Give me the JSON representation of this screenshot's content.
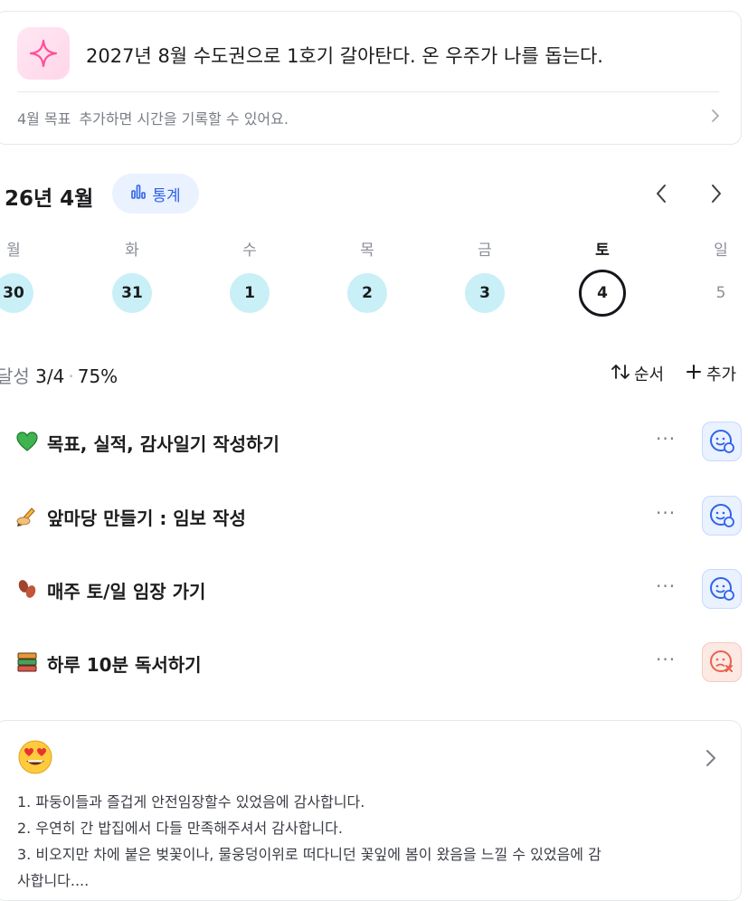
{
  "goal": {
    "text": "2027년 8월 수도권으로 1호기 갈아탄다. 온 우주가 나를 돕는다.",
    "sub_label": "4월 목표",
    "sub_text": "추가하면 시간을 기록할 수 있어요.",
    "icon": "sparkle-icon"
  },
  "calendar": {
    "month_title": "26년 4월",
    "stats_label": "통계",
    "weekdays": [
      "월",
      "화",
      "수",
      "목",
      "금",
      "토",
      "일"
    ],
    "days": [
      "30",
      "31",
      "1",
      "2",
      "3",
      "4",
      "5"
    ]
  },
  "progress": {
    "label": "달성",
    "count": "3/4",
    "percent": "75%",
    "sort_label": "순서",
    "add_label": "추가"
  },
  "tasks": [
    {
      "emoji": "green-heart-icon",
      "title": "목표, 실적, 감사일기 작성하기",
      "status": "done"
    },
    {
      "emoji": "writing-hand-icon",
      "title": "앞마당 만들기 : 임보 작성",
      "status": "done"
    },
    {
      "emoji": "footprints-icon",
      "title": "매주 토/일 임장 가기",
      "status": "done"
    },
    {
      "emoji": "books-icon",
      "title": "하루 10분 독서하기",
      "status": "missed"
    }
  ],
  "diary": {
    "emoji": "heart-eyes-icon",
    "lines": [
      "1. 파둥이들과 즐겁게 안전임장할수 있었음에 감사합니다.",
      "2. 우연히 간 밥집에서 다들 만족해주셔서 감사합니다.",
      "3. 비오지만 차에 붙은 벚꽃이나, 물웅덩이위로 떠다니던 꽃잎에 봄이 왔음을 느낄 수 있었음에 감",
      "사합니다...."
    ]
  },
  "colors": {
    "accent_blue": "#2e63e8",
    "done_day_bg": "#c9eff7",
    "fail_red": "#e8624a"
  }
}
